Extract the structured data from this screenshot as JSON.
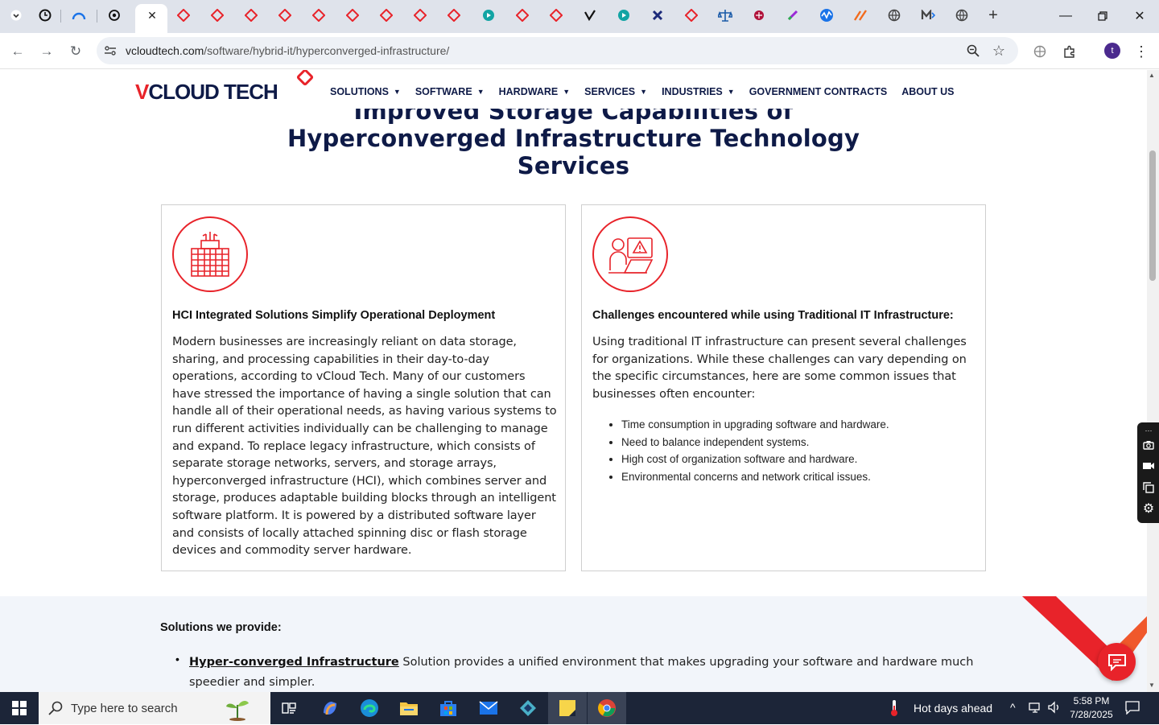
{
  "browser": {
    "url_host": "vcloudtech.com",
    "url_path": "/software/hybrid-it/hyperconverged-infrastructure/",
    "profile_initial": "t"
  },
  "site": {
    "logo_text_v": "V",
    "logo_text_rest": "CLOUD TECH",
    "nav": [
      {
        "label": "SOLUTIONS",
        "dropdown": true
      },
      {
        "label": "SOFTWARE",
        "dropdown": true
      },
      {
        "label": "HARDWARE",
        "dropdown": true
      },
      {
        "label": "SERVICES",
        "dropdown": true
      },
      {
        "label": "INDUSTRIES",
        "dropdown": true
      },
      {
        "label": "GOVERNMENT CONTRACTS",
        "dropdown": false
      },
      {
        "label": "ABOUT US",
        "dropdown": false
      }
    ],
    "accent_color": "#e8232a",
    "navy_color": "#0e1a47"
  },
  "hero": {
    "line1": "Improved Storage Capabilities of",
    "line2": "Hyperconverged Infrastructure Technology",
    "line3": "Services"
  },
  "cards": [
    {
      "icon": "building-icon",
      "title": "HCI Integrated Solutions Simplify Operational Deployment",
      "body": "Modern businesses are increasingly reliant on data storage, sharing, and processing capabilities in their day-to-day operations, according to vCloud Tech. Many of our customers have stressed the importance of having a single solution that can handle all of their operational needs, as having various systems to run different activities individually can be challenging to manage and expand. To replace legacy infrastructure, which consists of separate storage networks, servers, and storage arrays, hyperconverged infrastructure (HCI), which combines server and storage, produces adaptable building blocks through an intelligent software platform. It is powered by a distributed software layer and consists of locally attached spinning disc or flash storage devices and commodity server hardware."
    },
    {
      "icon": "warning-laptop-icon",
      "title": "Challenges encountered while using Traditional IT Infrastructure:",
      "body": "Using traditional IT infrastructure can present several challenges for organizations. While these challenges can vary depending on the specific circumstances, here are some common issues that businesses often encounter:",
      "list": [
        "Time consumption in upgrading software and hardware.",
        "Need to balance independent systems.",
        "High cost of organization software and hardware.",
        "Environmental concerns and network critical issues."
      ]
    }
  ],
  "solutions": {
    "title": "Solutions we provide:",
    "item_link": "Hyper-converged Infrastructure",
    "item_text": " Solution provides a unified environment that makes upgrading your software and hardware much speedier and simpler."
  },
  "taskbar": {
    "search_placeholder": "Type here to search",
    "weather": "Hot days ahead",
    "time": "5:58 PM",
    "date": "7/28/2025"
  }
}
